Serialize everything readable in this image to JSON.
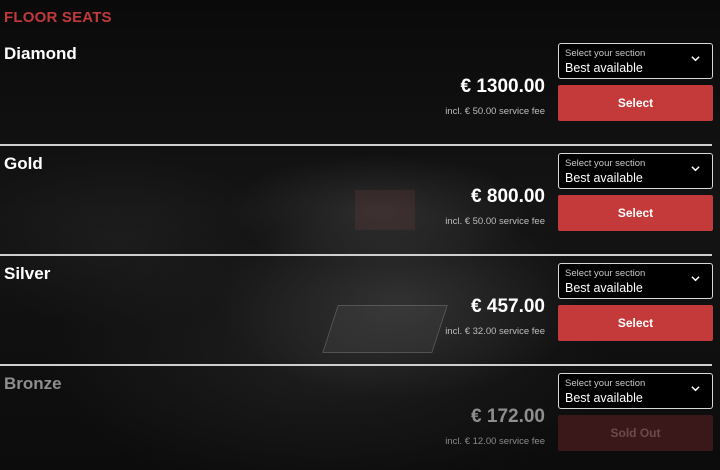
{
  "section_heading": "FLOOR SEATS",
  "colors": {
    "accent": "#c43a3b",
    "heading": "#c2393a",
    "sold_out_button": "#3a1718",
    "divider": "#cfcfcf"
  },
  "tiers": [
    {
      "name": "Diamond",
      "select_label": "Select your section",
      "select_value": "Best available",
      "price": "€ 1300.00",
      "fee": "incl. € 50.00 service fee",
      "button": "Select",
      "status": "available"
    },
    {
      "name": "Gold",
      "select_label": "Select your section",
      "select_value": "Best available",
      "price": "€ 800.00",
      "fee": "incl. € 50.00 service fee",
      "button": "Select",
      "status": "available"
    },
    {
      "name": "Silver",
      "select_label": "Select your section",
      "select_value": "Best available",
      "price": "€ 457.00",
      "fee": "incl. € 32.00 service fee",
      "button": "Select",
      "status": "available"
    },
    {
      "name": "Bronze",
      "select_label": "Select your section",
      "select_value": "Best available",
      "price": "€ 172.00",
      "fee": "incl. € 12.00 service fee",
      "button": "Sold Out",
      "status": "sold out"
    }
  ],
  "icons": {
    "dropdown": "chevron-down-icon"
  }
}
